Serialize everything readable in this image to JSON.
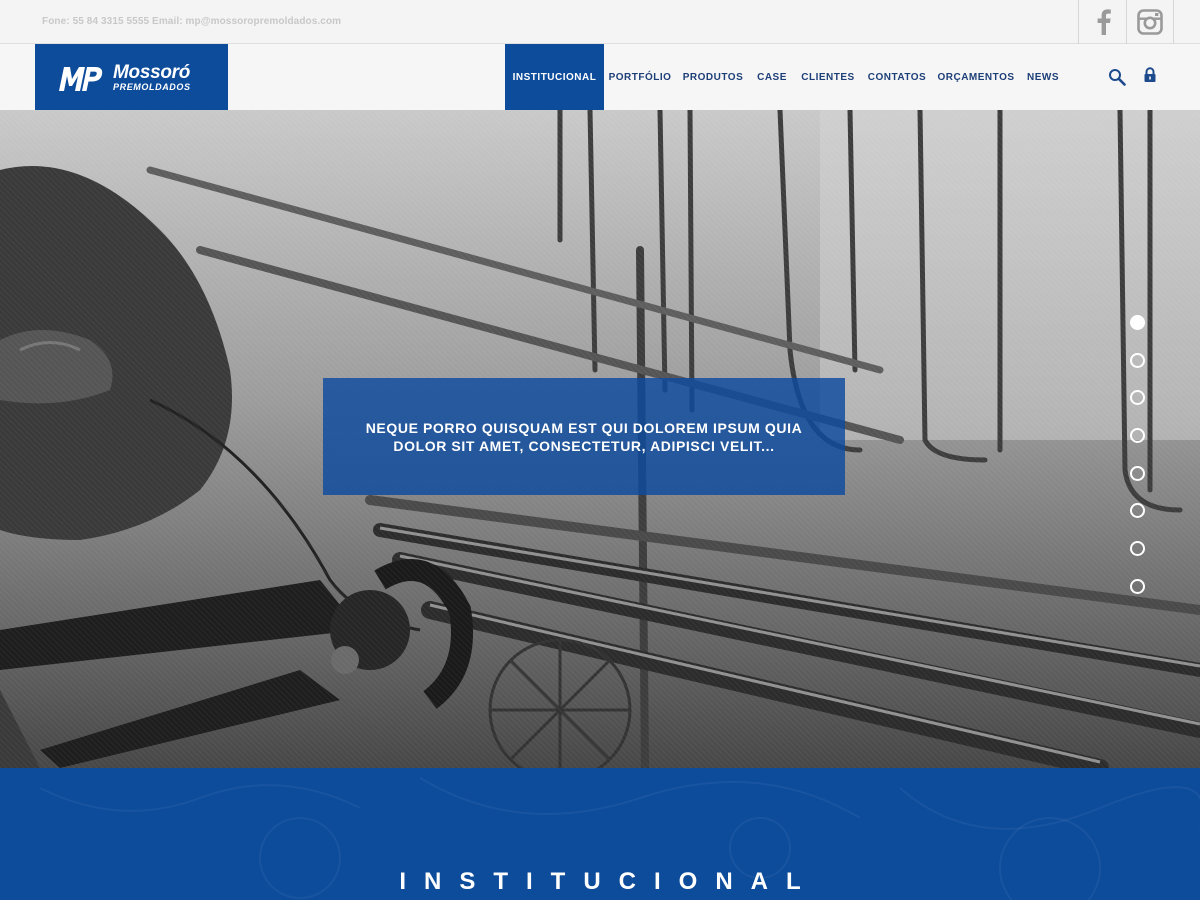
{
  "topbar": {
    "contact": "Fone: 55 84 3315 5555 Email: mp@mossoropremoldados.com",
    "social": [
      {
        "name": "facebook-icon"
      },
      {
        "name": "instagram-icon"
      }
    ]
  },
  "brand": {
    "name": "Mossoró",
    "subtitle": "PREMOLDADOS",
    "color": "#0d4b9b"
  },
  "nav": {
    "items": [
      {
        "label": "INSTITUCIONAL",
        "active": true
      },
      {
        "label": "PORTFÓLIO",
        "active": false
      },
      {
        "label": "PRODUTOS",
        "active": false
      },
      {
        "label": "CASE",
        "active": false
      },
      {
        "label": "CLIENTES",
        "active": false
      },
      {
        "label": "CONTATOS",
        "active": false
      },
      {
        "label": "ORÇAMENTOS",
        "active": false
      },
      {
        "label": "NEWS",
        "active": false
      }
    ],
    "icons": [
      "search-icon",
      "lock-icon"
    ]
  },
  "hero": {
    "caption": "NEQUE PORRO QUISQUAM EST QUI DOLOREM IPSUM QUIA DOLOR SIT AMET, CONSECTETUR, ADIPISCI VELIT...",
    "slides_total": 8,
    "slide_active": 1
  },
  "section": {
    "title": "INSTITUCIONAL"
  }
}
